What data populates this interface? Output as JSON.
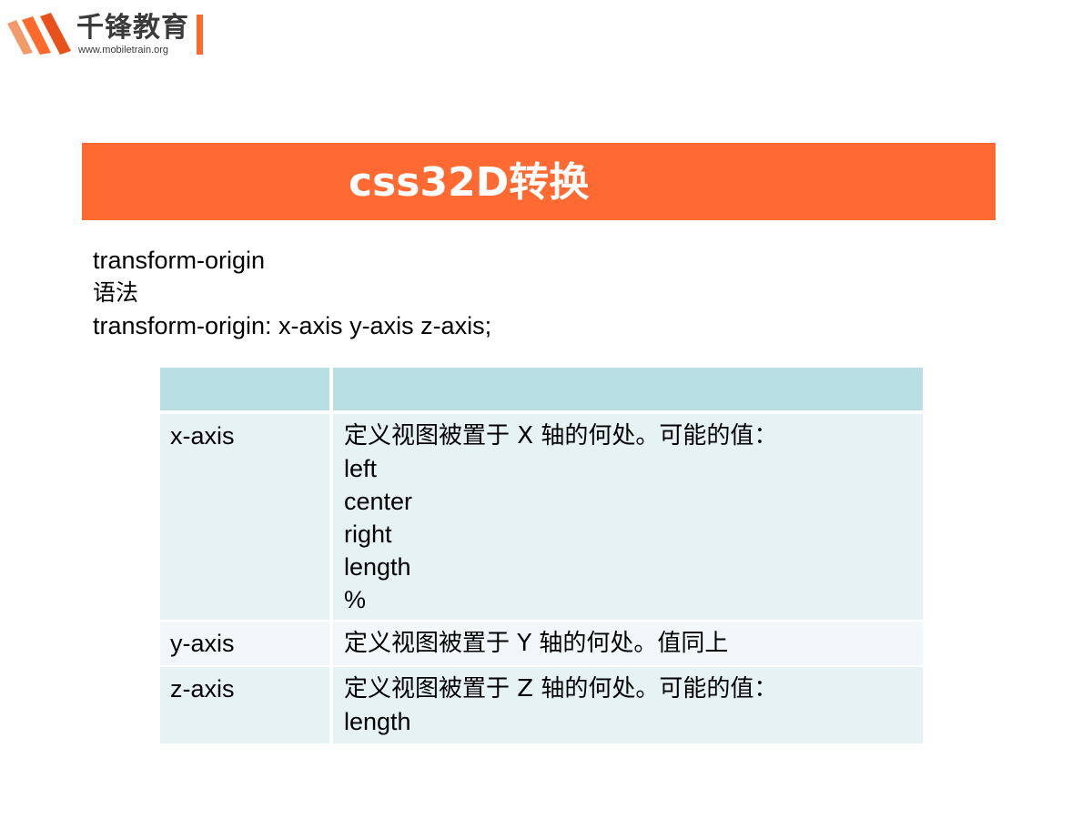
{
  "logo": {
    "name": "千锋教育",
    "url": "www.mobiletrain.org",
    "colors": {
      "accent": "#ff6a2c",
      "text": "#3a3a3a"
    }
  },
  "title": "css32D转换",
  "intro": {
    "property": "transform-origin",
    "syntax_label": "语法",
    "syntax": "transform-origin: x-axis y-axis z-axis;"
  },
  "table": {
    "header": [
      "",
      ""
    ],
    "rows": [
      {
        "param": "x-axis",
        "desc": [
          "定义视图被置于 X 轴的何处。可能的值：",
          "left",
          "center",
          "right",
          "length",
          "%"
        ]
      },
      {
        "param": "y-axis",
        "desc": [
          "定义视图被置于 Y 轴的何处。值同上"
        ]
      },
      {
        "param": "z-axis",
        "desc": [
          "定义视图被置于 Z 轴的何处。可能的值：",
          "length"
        ]
      }
    ]
  },
  "colors": {
    "title_band": "#ff6a33",
    "table_header": "#b8e0e4",
    "table_row_odd": "#e6f2f3",
    "table_row_even": "#f2f8f9"
  }
}
